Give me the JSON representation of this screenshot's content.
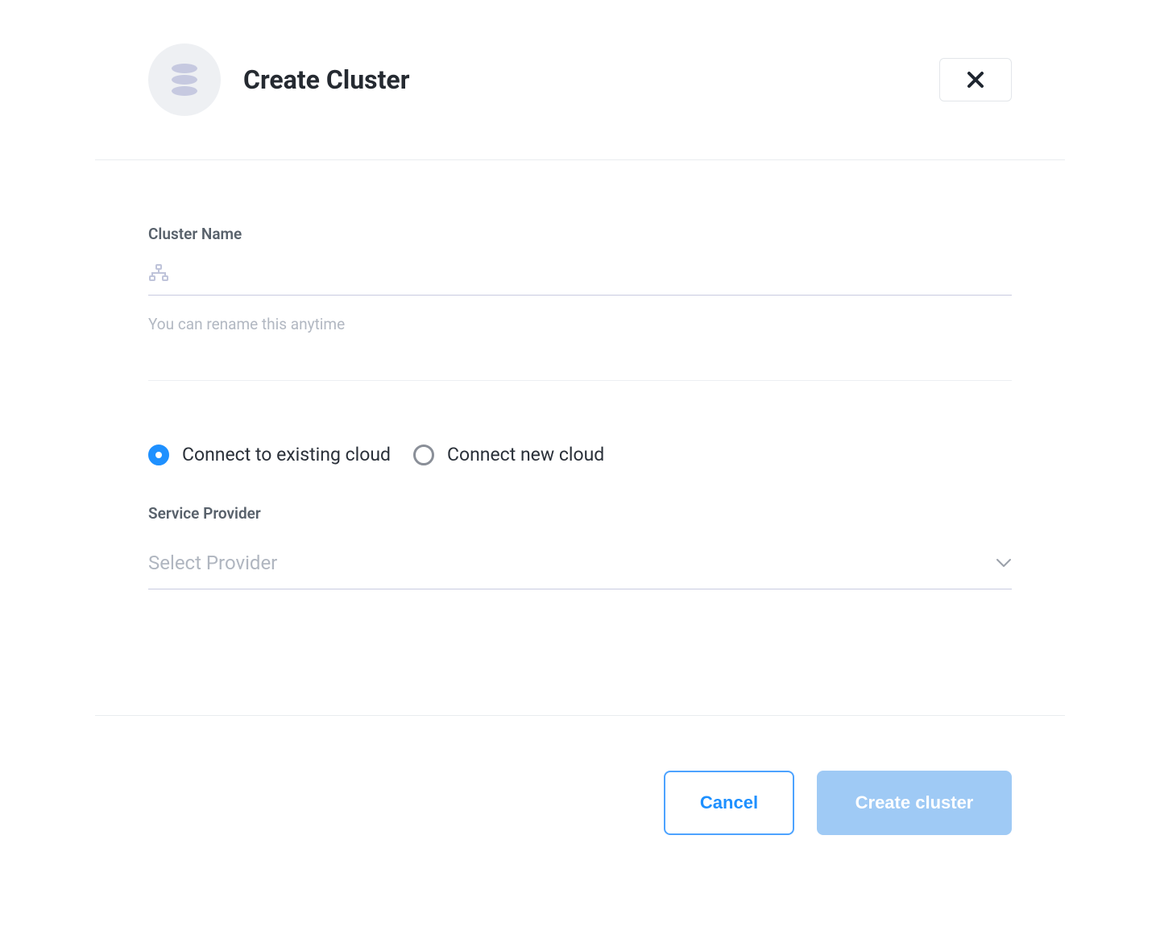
{
  "header": {
    "title": "Create Cluster"
  },
  "form": {
    "cluster_name": {
      "label": "Cluster Name",
      "value": "",
      "helper": "You can rename this anytime"
    },
    "cloud_connection": {
      "options": [
        {
          "label": "Connect to existing cloud",
          "selected": true
        },
        {
          "label": "Connect new cloud",
          "selected": false
        }
      ]
    },
    "service_provider": {
      "label": "Service Provider",
      "placeholder": "Select Provider"
    }
  },
  "footer": {
    "cancel_label": "Cancel",
    "submit_label": "Create cluster"
  },
  "colors": {
    "accent": "#1e90ff",
    "muted": "#b2b8c2",
    "border": "#c8cbe0"
  }
}
